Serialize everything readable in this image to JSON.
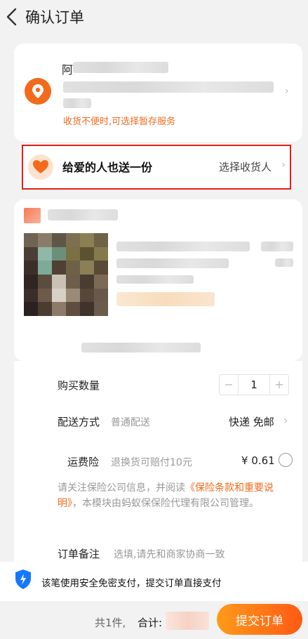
{
  "header": {
    "title": "确认订单",
    "back_icon": "chevron-left-icon"
  },
  "address": {
    "name_initial": "阿",
    "note": "收货不便时,可选择暂存服务",
    "accent_color": "#f26a1b"
  },
  "gift": {
    "label": "给爱的人也送一份",
    "action": "选择收货人"
  },
  "order": {
    "quantity_label": "购买数量",
    "quantity": "1",
    "minus": "−",
    "plus": "+",
    "delivery_label": "配送方式",
    "delivery_desc": "普通配送",
    "delivery_value": "快递 免邮",
    "insurance_label": "运费险",
    "insurance_desc": "退换货可赔付10元",
    "insurance_price": "¥ 0.61",
    "insurance_note_pre": "请关注保险公司信息，并阅读",
    "insurance_note_link": "《保险条款和重要说明》",
    "insurance_note_post": "，本模块由蚂蚁保保险代理有限公司管理。",
    "remark_label": "订单备注",
    "remark_placeholder": "选填,请先和商家协商一致"
  },
  "payment": {
    "secure_text": "该笔使用安全免密支付，提交订单直接支付"
  },
  "footer": {
    "count": "共1件,",
    "total_label": "合计:",
    "submit": "提交订单",
    "submit_color": "#ff6a14"
  }
}
